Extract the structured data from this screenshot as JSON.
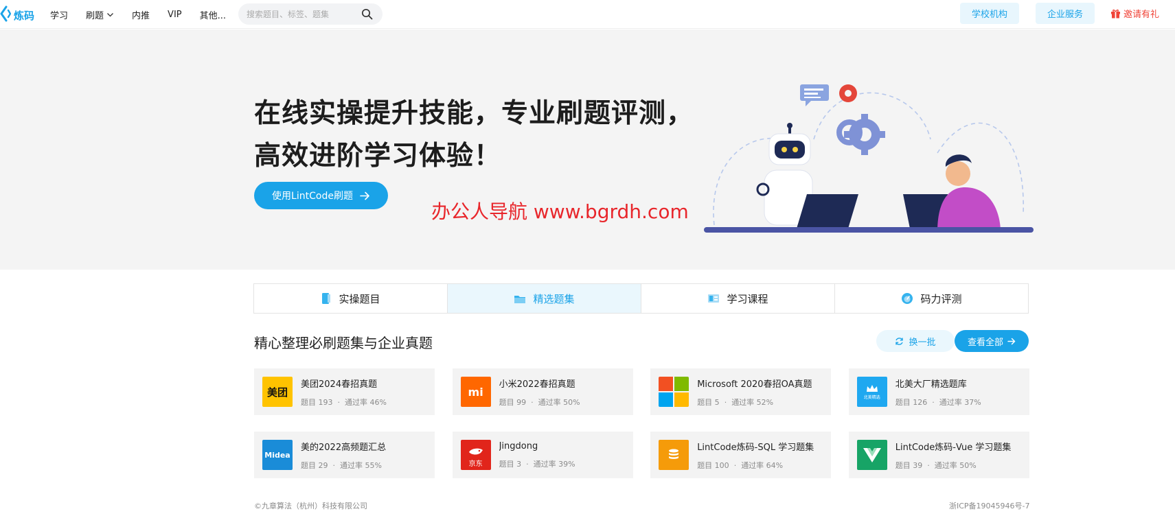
{
  "header": {
    "logo_text": "炼码",
    "nav": [
      {
        "label": "学习"
      },
      {
        "label": "刷题"
      },
      {
        "label": "内推"
      },
      {
        "label": "VIP"
      },
      {
        "label": "其他..."
      }
    ],
    "search_placeholder": "搜索题目、标签、题集",
    "school_label": "学校机构",
    "enterprise_label": "企业服务",
    "invite_label": "邀请有礼"
  },
  "hero": {
    "title_line1": "在线实操提升技能，专业刷题评测，",
    "title_line2": "高效进阶学习体验！",
    "cta_label": "使用LintCode刷题",
    "watermark": "办公人导航 www.bgrdh.com"
  },
  "tabs": [
    {
      "label": "实操题目",
      "icon": "book-icon"
    },
    {
      "label": "精选题集",
      "icon": "folder-icon"
    },
    {
      "label": "学习课程",
      "icon": "course-icon"
    },
    {
      "label": "码力评测",
      "icon": "gauge-icon"
    }
  ],
  "section": {
    "title": "精心整理必刷题集与企业真题",
    "swap_label": "换一批",
    "view_all_label": "查看全部"
  },
  "cards": [
    {
      "name": "美团2024春招真题",
      "count": "题目 193",
      "rate": "通过率 46%",
      "logo_text": "美团"
    },
    {
      "name": "小米2022春招真题",
      "count": "题目 99",
      "rate": "通过率 50%",
      "logo_text": "mi"
    },
    {
      "name": "Microsoft 2020春招OA真题",
      "count": "题目 5",
      "rate": "通过率 52%",
      "logo_text": ""
    },
    {
      "name": "北美大厂精选题库",
      "count": "题目 126",
      "rate": "通过率 37%",
      "logo_text": "北美精选"
    },
    {
      "name": "美的2022高频题汇总",
      "count": "题目 29",
      "rate": "通过率 55%",
      "logo_text": "Midea"
    },
    {
      "name": "Jingdong",
      "count": "题目 3",
      "rate": "通过率 39%",
      "logo_text": "京东"
    },
    {
      "name": "LintCode炼码-SQL 学习题集",
      "count": "题目 100",
      "rate": "通过率 64%",
      "logo_text": ""
    },
    {
      "name": "LintCode炼码-Vue 学习题集",
      "count": "题目 39",
      "rate": "通过率 50%",
      "logo_text": ""
    }
  ],
  "footer": {
    "copyright": "©九章算法（杭州）科技有限公司",
    "icp": "浙ICP备19045946号-7"
  },
  "colors": {
    "accent": "#1aa3e8",
    "accent_light": "#eaf7fd",
    "invite_red": "#f04438",
    "hero_bg": "#f4f4f4"
  }
}
